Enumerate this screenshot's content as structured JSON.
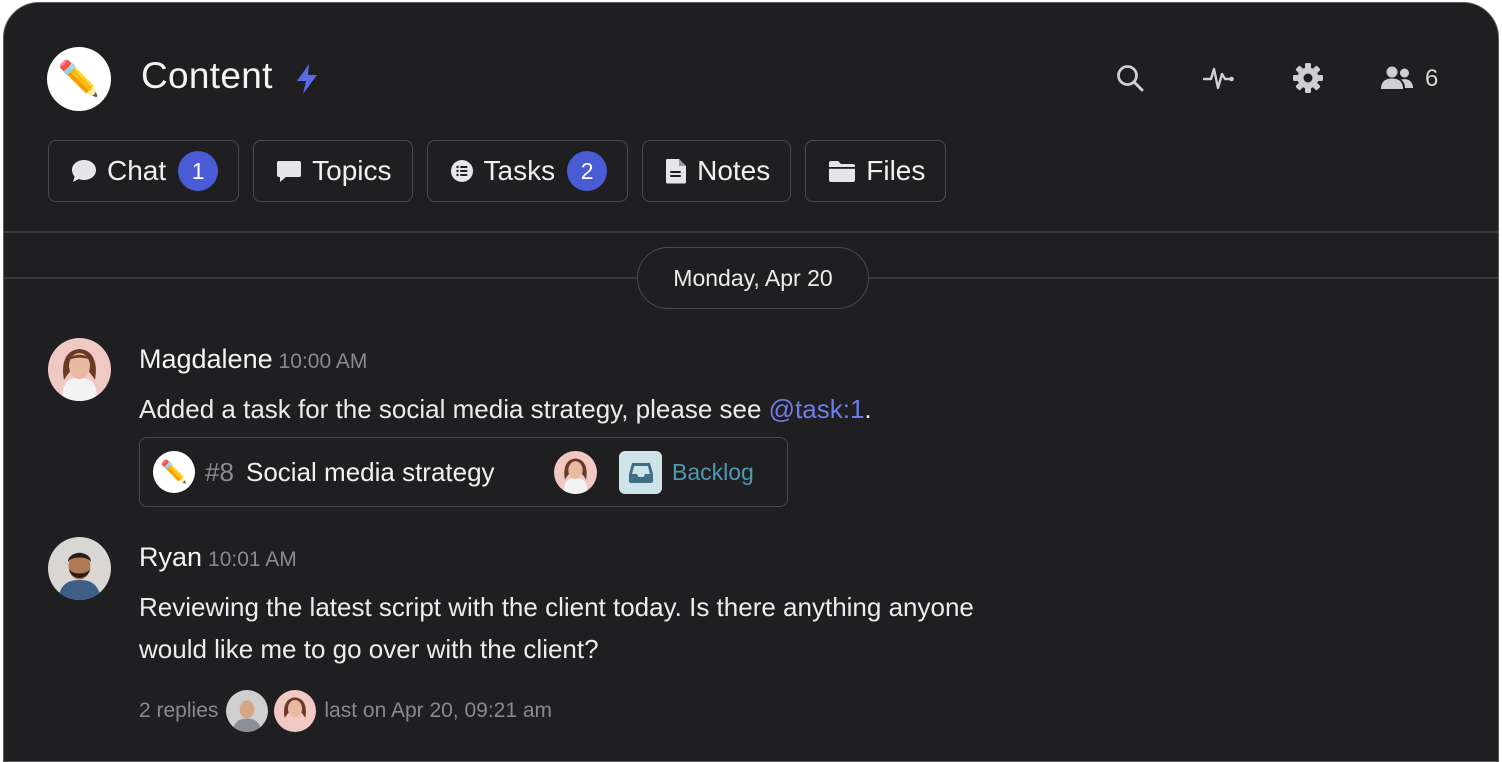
{
  "channel": {
    "title": "Content",
    "logo_icon": "pencil-icon",
    "accent": "#4a5bd6"
  },
  "header_actions": {
    "members_count": "6"
  },
  "tabs": [
    {
      "label": "Chat",
      "badge": "1",
      "icon": "chat-bubble-icon"
    },
    {
      "label": "Topics",
      "icon": "topics-icon"
    },
    {
      "label": "Tasks",
      "badge": "2",
      "icon": "tasks-list-icon"
    },
    {
      "label": "Notes",
      "icon": "note-icon"
    },
    {
      "label": "Files",
      "icon": "folder-icon"
    }
  ],
  "date_separator": "Monday, Apr 20",
  "messages": [
    {
      "author": "Magdalene",
      "time": "10:00 AM",
      "text_before": "Added a task for the social media strategy, please see ",
      "mention": "@task:1",
      "text_after": ".",
      "task": {
        "number": "#8",
        "title": "Social media strategy",
        "status": "Backlog"
      }
    },
    {
      "author": "Ryan",
      "time": "10:01 AM",
      "line1": "Reviewing the latest script with the client today. Is there anything anyone",
      "line2": "would like me to go over with the client?",
      "replies": {
        "count_label": "2 replies",
        "last": "last on Apr 20, 09:21 am"
      }
    }
  ]
}
